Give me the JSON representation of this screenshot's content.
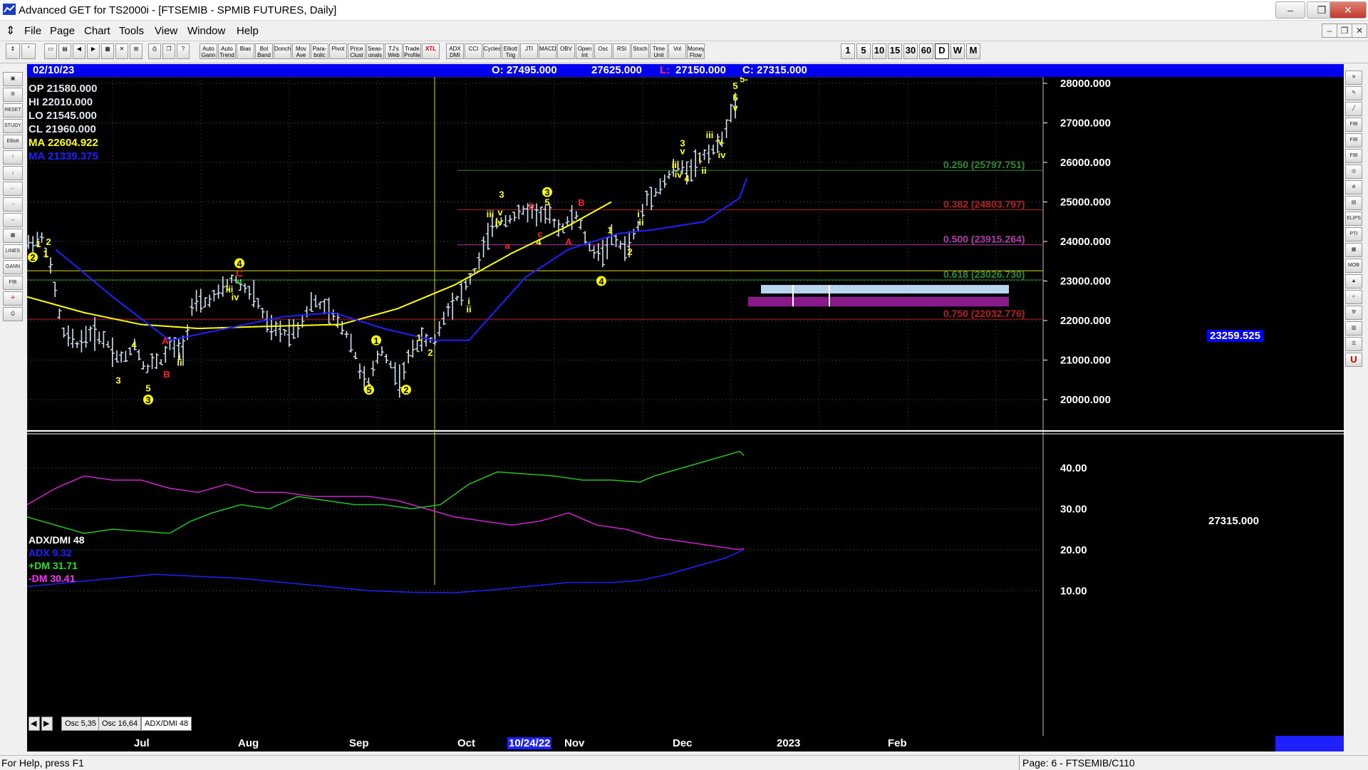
{
  "window": {
    "title": "Advanced GET for TS2000i - [FTSEMIB - SPMIB FUTURES, Daily]",
    "controls": [
      "–",
      "❐",
      "✕"
    ]
  },
  "menu": {
    "items": [
      "File",
      "Page",
      "Chart",
      "Tools",
      "View",
      "Window",
      "Help"
    ],
    "mdi_controls": [
      "–",
      "❐",
      "✕"
    ]
  },
  "toolbar": {
    "buttons": [
      "Auto Gann",
      "Auto Trend",
      "Bias",
      "Bol Band",
      "Donch",
      "Mov Ave",
      "Para-bolic",
      "Pivot",
      "Price Clust",
      "Seas-onals",
      "TJ's Web",
      "Trade Profile",
      "XTL",
      "ADX DMI",
      "CCI",
      "Cycles",
      "Elliott Trig",
      "JTI",
      "MACD",
      "OBV",
      "Open Int",
      "Osc",
      "RSI",
      "Stoch",
      "Time Unit",
      "Vol",
      "Money Flow"
    ],
    "timeframes": [
      "1",
      "5",
      "10",
      "15",
      "30",
      "60",
      "D",
      "W",
      "M"
    ]
  },
  "infostrip": {
    "date": "02/10/23",
    "open": "O: 27495.000",
    "high": "27625.000",
    "low_label": "L:",
    "low": "27150.000",
    "close": "C: 27315.000"
  },
  "ohlc_panel": {
    "op": "OP  21580.000",
    "hi": "HI   22010.000",
    "lo": "LO  21545.000",
    "cl": "CL  21960.000",
    "ma1": "MA  22604.922",
    "ma2": "MA  21339.375"
  },
  "price_axis": [
    "28000.000",
    "27000.000",
    "26000.000",
    "25000.000",
    "24000.000",
    "23000.000",
    "22000.000",
    "21000.000",
    "20000.000"
  ],
  "current_price_tag": "23259.525",
  "last_price": "27315.000",
  "fib_levels": [
    {
      "label": "0.250 (25797.751)",
      "price": 25797.751,
      "color": "#2e8b2e"
    },
    {
      "label": "0.382 (24803.797)",
      "price": 24803.797,
      "color": "#b22222"
    },
    {
      "label": "0.500 (23915.264)",
      "price": 23915.264,
      "color": "#b23aa8"
    },
    {
      "label": "0.618 (23026.730)",
      "price": 23026.73,
      "color": "#2e8b2e"
    },
    {
      "label": "0.750 (22032.776)",
      "price": 22032.776,
      "color": "#b22222"
    }
  ],
  "indicator": {
    "title": "ADX/DMI 48",
    "adx": "ADX 9.32",
    "plus_dm": "+DM 31.71",
    "minus_dm": "-DM 30.41",
    "axis": [
      "40.00",
      "30.00",
      "20.00",
      "10.00"
    ]
  },
  "tabs": [
    "Osc 5,35",
    "Osc 16,64",
    "ADX/DMI 48"
  ],
  "date_axis": {
    "months": [
      "Jul",
      "Aug",
      "Sep",
      "Oct",
      "10/24/22",
      "Nov",
      "Dec",
      "2023",
      "Feb"
    ]
  },
  "status": {
    "help": "For Help, press F1",
    "page": "Page: 6 - FTSEMIB/C110"
  },
  "colors": {
    "background": "#000000",
    "bars": "#cfe0f0",
    "ma_fast": "#ffff00",
    "ma_slow": "#2020ff",
    "plus_dm": "#22c222",
    "minus_dm": "#cc22cc",
    "adx": "#2020ff",
    "wave_label": "#ffff00",
    "wave_red": "#ff2020"
  },
  "wave_labels": [
    "2",
    "1",
    "1",
    "2",
    "4",
    "C",
    "v",
    "iii",
    "iv",
    "4",
    "A",
    "i",
    "ii",
    "3",
    "5",
    "3",
    "B",
    "1",
    "5",
    "2",
    "1",
    "2",
    "i",
    "ii",
    "iii",
    "iv",
    "v",
    "3",
    "3",
    "5",
    "4",
    "b",
    "c",
    "a",
    "B",
    "A",
    "1",
    "2",
    "4",
    "i",
    "ii",
    "3",
    "v",
    "iii",
    "iv",
    "4",
    "ii",
    "i",
    "iii",
    "v",
    "iv",
    "5",
    "5",
    "5",
    "v",
    "5-"
  ]
}
